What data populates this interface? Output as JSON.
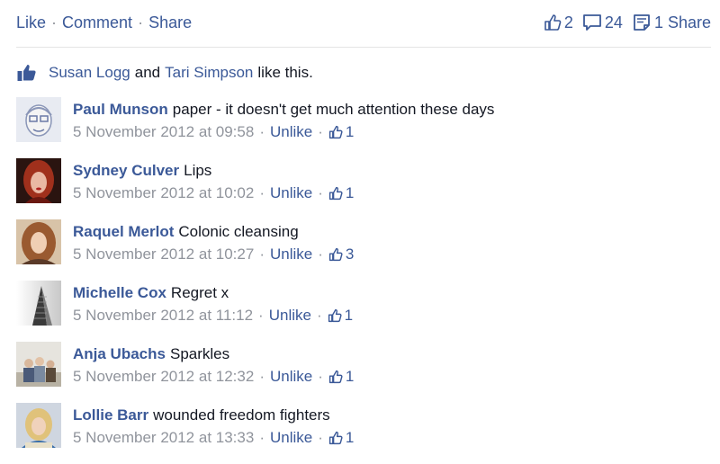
{
  "actions": {
    "like_label": "Like",
    "comment_label": "Comment",
    "share_label": "Share",
    "separator": "·"
  },
  "stats": {
    "likes": "2",
    "comments": "24",
    "shares": "1 Share"
  },
  "likes_summary": {
    "user1": "Susan Logg",
    "and": "and",
    "user2": "Tari Simpson",
    "suffix": "like this."
  },
  "comments": [
    {
      "author": "Paul Munson",
      "text": "paper - it doesn't get much attention these days",
      "time": "5 November 2012 at 09:58",
      "unlike": "Unlike",
      "likes": "1",
      "avatar": "sketch-face"
    },
    {
      "author": "Sydney Culver",
      "text": "Lips",
      "time": "5 November 2012 at 10:02",
      "unlike": "Unlike",
      "likes": "1",
      "avatar": "red-hair-portrait"
    },
    {
      "author": "Raquel Merlot",
      "text": "Colonic cleansing",
      "time": "5 November 2012 at 10:27",
      "unlike": "Unlike",
      "likes": "3",
      "avatar": "curly-hair-portrait"
    },
    {
      "author": "Michelle Cox",
      "text": "Regret x",
      "time": "5 November 2012 at 11:12",
      "unlike": "Unlike",
      "likes": "1",
      "avatar": "building-photo"
    },
    {
      "author": "Anja Ubachs",
      "text": "Sparkles",
      "time": "5 November 2012 at 12:32",
      "unlike": "Unlike",
      "likes": "1",
      "avatar": "group-photo"
    },
    {
      "author": "Lollie Barr",
      "text": "wounded freedom fighters",
      "time": "5 November 2012 at 13:33",
      "unlike": "Unlike",
      "likes": "1",
      "avatar": "blonde-portrait"
    }
  ],
  "colors": {
    "link": "#3b5998",
    "meta": "#90949c",
    "text": "#141823"
  }
}
